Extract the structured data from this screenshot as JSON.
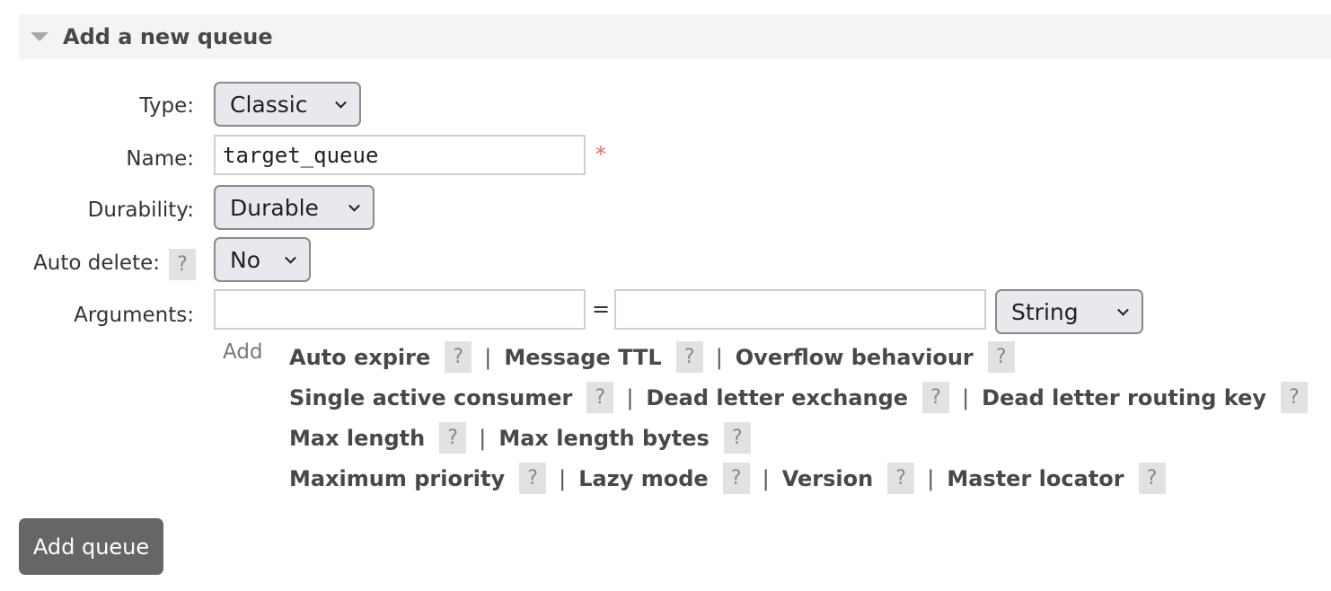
{
  "section": {
    "title": "Add a new queue"
  },
  "form": {
    "type": {
      "label": "Type:",
      "value": "Classic"
    },
    "name": {
      "label": "Name:",
      "value": "target_queue",
      "required_mark": "*"
    },
    "durability": {
      "label": "Durability:",
      "value": "Durable"
    },
    "auto_delete": {
      "label": "Auto delete:",
      "help": "?",
      "value": "No"
    },
    "arguments": {
      "label": "Arguments:",
      "key_value": "",
      "equals": "=",
      "value_value": "",
      "type_value": "String",
      "add_label": "Add"
    }
  },
  "argument_shortcuts": {
    "help": "?",
    "separator": "|",
    "rows": [
      [
        "Auto expire",
        "Message TTL",
        "Overflow behaviour"
      ],
      [
        "Single active consumer",
        "Dead letter exchange",
        "Dead letter routing key"
      ],
      [
        "Max length",
        "Max length bytes"
      ],
      [
        "Maximum priority",
        "Lazy mode",
        "Version",
        "Master locator"
      ]
    ]
  },
  "submit": {
    "label": "Add queue"
  }
}
